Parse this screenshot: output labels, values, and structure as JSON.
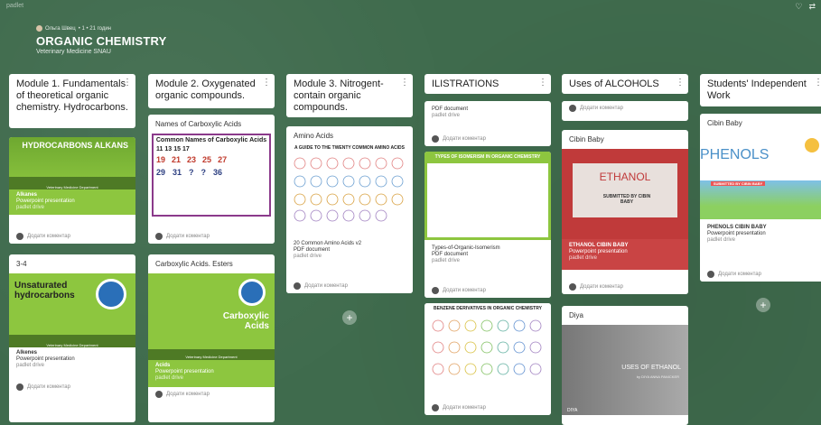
{
  "app": {
    "brand": "padlet",
    "icons": [
      "heart-icon",
      "share-icon"
    ]
  },
  "header": {
    "author": "Ольга Швец",
    "meta_suffix": "• 1 • 21 годин",
    "title": "ORGANIC CHEMISTRY",
    "subtitle": "Veterinary Medicine SNAU"
  },
  "comment_label": "Додати коментар",
  "columns": [
    {
      "heading": "Module 1. Fundamentals of theoretical organic chemistry. Hydrocarbons.",
      "cards": [
        {
          "thumb_text": "HYDROCARBONS ALKANS",
          "dept": "Veterinary Medicine Department",
          "name": "Alkanes",
          "kind": "Powerpoint presentation",
          "src": "padlet drive"
        },
        {
          "title": "3-4",
          "thumb_text": "Unsaturated hydrocarbons",
          "dept": "Veterinary Medicine Department",
          "name": "Alkenes",
          "kind": "Powerpoint presentation",
          "src": "padlet drive"
        }
      ]
    },
    {
      "heading": "Module 2. Oxygenated organic compounds.",
      "cards": [
        {
          "title": "Names of Carboxylic Acids",
          "thumb_text": "Common Names of Carboxylic Acids",
          "numbers": [
            "19",
            "21",
            "23",
            "25",
            "27",
            "29",
            "31",
            "?",
            "?",
            "36",
            "11",
            "13",
            "15",
            "17"
          ]
        },
        {
          "title": "Carboxylic Acids. Esters",
          "thumb_text": "Carboxylic Acids",
          "dept": "Veterinary Medicine Department",
          "name": "Acids",
          "kind": "Powerpoint presentation",
          "src": "padlet drive"
        }
      ]
    },
    {
      "heading": "Module 3. Nitrogent-contain organic compounds.",
      "cards": [
        {
          "title": "Amino Acids",
          "thumb_text": "A GUIDE TO THE TWENTY COMMON AMINO ACIDS",
          "name": "20 Common Amino Acids v2",
          "kind": "PDF document",
          "src": "padlet drive"
        }
      ]
    },
    {
      "heading": "ILISTRATIONS",
      "cards": [
        {
          "kind": "PDF document",
          "src": "padlet drive"
        },
        {
          "thumb_text": "TYPES OF ISOMERISM IN ORGANIC CHEMISTRY",
          "name": "Types-of-Organic-Isomerism",
          "kind": "PDF document",
          "src": "padlet drive"
        },
        {
          "thumb_text": "BENZENE DERIVATIVES IN ORGANIC CHEMISTRY"
        }
      ]
    },
    {
      "heading": "Uses of ALCOHOLS",
      "cards": [
        {
          "title": "Cibin Baby",
          "thumb_text": "ETHANOL",
          "thumb_sub": "SUBMITTED BY CIBIN BABY",
          "name": "ETHANOL CIBIN BABY",
          "kind": "Powerpoint presentation",
          "src": "padlet drive"
        },
        {
          "title": "Diya",
          "thumb_text": "USES OF ETHANOL",
          "thumb_sub": "by DIYA ANNA PANICKER",
          "footer": "DIYA"
        }
      ]
    },
    {
      "heading": "Students' Independent Work",
      "cards": [
        {
          "title": "Cibin Baby",
          "thumb_text": "PHENOLS",
          "thumb_sub": "SUBMITTED BY CIBIN BABY",
          "name": "PHENOLS CIBIN BABY",
          "kind": "Powerpoint presentation",
          "src": "padlet drive"
        }
      ]
    }
  ],
  "add_label": "+"
}
